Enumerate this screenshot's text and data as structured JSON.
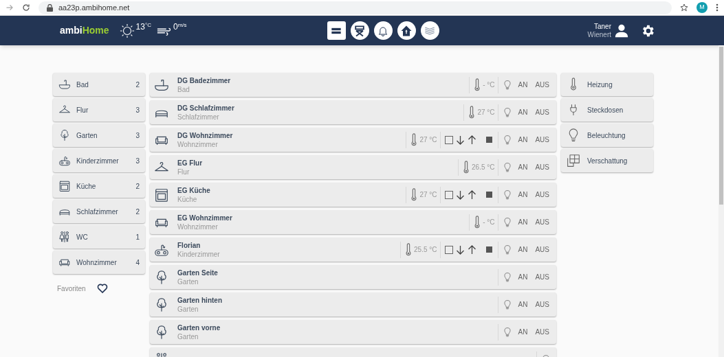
{
  "browser": {
    "url": "aa23p.ambihome.net",
    "avatar": "M"
  },
  "header": {
    "logo": [
      "ambi",
      "Home"
    ],
    "temperature": "13$^{°C}$",
    "wind": "0$^{m/s}$",
    "views": [
      {
        "kind": "list",
        "selected": true
      },
      {
        "kind": "chair",
        "selected": false
      },
      {
        "kind": "bell",
        "selected": false
      },
      {
        "kind": "home",
        "selected": false
      },
      {
        "kind": "layers",
        "selected": false
      }
    ],
    "user": {
      "first_name": "Taner",
      "last_name": "Wienert"
    }
  },
  "room_types": [
    {
      "kind": "bath",
      "label": "Bad",
      "count": "2"
    },
    {
      "kind": "hanger",
      "label": "Flur",
      "count": "3"
    },
    {
      "kind": "tree",
      "label": "Garten",
      "count": "3"
    },
    {
      "kind": "gamepad",
      "label": "Kinderzimmer",
      "count": "3"
    },
    {
      "kind": "stove",
      "label": "Küche",
      "count": "2"
    },
    {
      "kind": "bed",
      "label": "Schlafzimmer",
      "count": "2"
    },
    {
      "kind": "wc",
      "label": "WC",
      "count": "1"
    },
    {
      "kind": "sofa",
      "label": "Wohnzimmer",
      "count": "4"
    }
  ],
  "favorites": {
    "label": "Favoriten"
  },
  "rooms": [
    {
      "kind": "bath",
      "name": "DG Badezimmer",
      "type": "Bad",
      "temperature": "- °C",
      "on": "AN",
      "off": "AUS"
    },
    {
      "kind": "bed",
      "name": "DG Schlafzimmer",
      "type": "Schlafzimmer",
      "temperature": "27 °C",
      "on": "AN",
      "off": "AUS"
    },
    {
      "kind": "sofa",
      "name": "DG Wohnzimmer",
      "type": "Wohnzimmer",
      "temperature": "27 °C",
      "shutter": {
        "checked": false
      },
      "on": "AN",
      "off": "AUS"
    },
    {
      "kind": "hanger",
      "name": "EG Flur",
      "type": "Flur",
      "temperature": "26.5 °C",
      "on": "AN",
      "off": "AUS"
    },
    {
      "kind": "stove",
      "name": "EG Küche",
      "type": "Küche",
      "temperature": "27 °C",
      "shutter": {
        "checked": false
      },
      "on": "AN",
      "off": "AUS"
    },
    {
      "kind": "sofa",
      "name": "EG Wohnzimmer",
      "type": "Wohnzimmer",
      "temperature": "- °C",
      "on": "AN",
      "off": "AUS"
    },
    {
      "kind": "gamepad",
      "name": "Florian",
      "type": "Kinderzimmer",
      "temperature": "25.5 °C",
      "shutter": {
        "checked": false
      },
      "on": "AN",
      "off": "AUS"
    },
    {
      "kind": "tree",
      "name": "Garten Seite",
      "type": "Garten",
      "on": "AN",
      "off": "AUS"
    },
    {
      "kind": "tree",
      "name": "Garten hinten",
      "type": "Garten",
      "on": "AN",
      "off": "AUS"
    },
    {
      "kind": "tree",
      "name": "Garten vorne",
      "type": "Garten",
      "on": "AN",
      "off": "AUS"
    },
    {
      "kind": "wc"
    }
  ],
  "functions": [
    {
      "kind": "thermometer",
      "label": "Heizung"
    },
    {
      "kind": "plug",
      "label": "Steckdosen"
    },
    {
      "kind": "bulb",
      "label": "Beleuchtung"
    },
    {
      "kind": "window",
      "label": "Verschattung"
    }
  ]
}
